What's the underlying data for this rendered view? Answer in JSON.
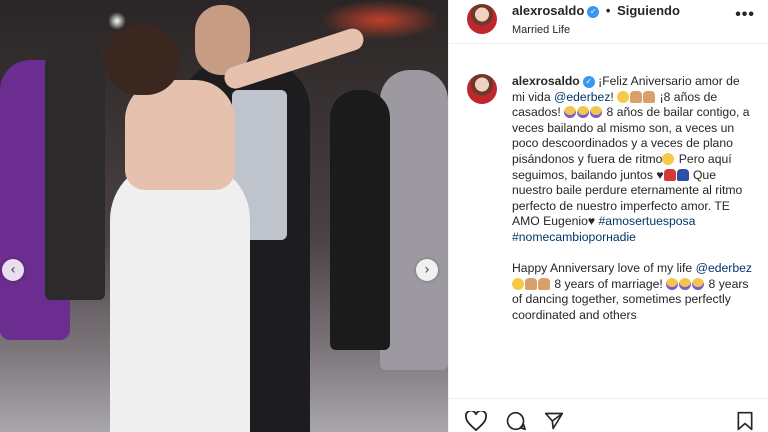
{
  "header": {
    "username": "alexrosaldo",
    "follow_separator": "•",
    "follow_label": "Siguiendo",
    "subtitle": "Married Life",
    "more_label": "•••"
  },
  "caption": {
    "username": "alexrosaldo",
    "part1": "¡Feliz Aniversario amor de mi vida ",
    "mention1": "@ederbez",
    "part2": "! ",
    "part3": " ¡8 años de casados! ",
    "part4": " 8 años de bailar contigo, a veces bailando al mismo son, a veces un poco descoordinados y a veces de plano pisándonos y fuera de ritmo",
    "part5": " Pero aquí seguimos, bailando juntos ",
    "part6": " Que nuestro baile perdure eternamente al ritmo perfecto de nuestro imperfecto amor. TE AMO Eugenio",
    "heart": "♥",
    "tag1": "#amosertuesposa",
    "tag2": "#nomecambioporнadie",
    "en_part1": "Happy Anniversary love of my life ",
    "en_mention": "@ederbez",
    "en_part2": " 8 years of marriage! ",
    "en_part3": " 8 years of dancing together, sometimes perfectly coordinated and others"
  },
  "nav": {
    "left": "‹",
    "right": "›"
  },
  "colors": {
    "link": "#00376b",
    "verified": "#3897f0",
    "text": "#262626"
  },
  "icons": [
    "heart-icon",
    "comment-icon",
    "share-icon",
    "bookmark-icon"
  ]
}
